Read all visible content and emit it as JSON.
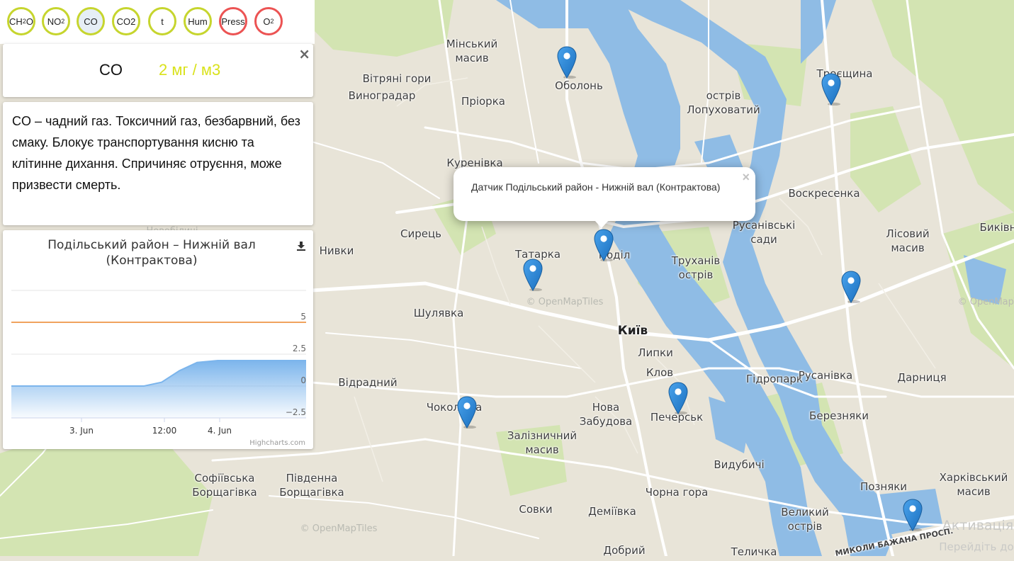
{
  "chips": [
    {
      "label": "CH",
      "sub": "2",
      "tail": "O",
      "color": "#c6d52e"
    },
    {
      "label": "NO",
      "sub": "2",
      "tail": "",
      "color": "#c6d52e"
    },
    {
      "label": "CO",
      "sub": "",
      "tail": "",
      "color": "#c6d52e",
      "active": true
    },
    {
      "label": "CO2",
      "sub": "",
      "tail": "",
      "color": "#c6d52e"
    },
    {
      "label": "t",
      "sub": "",
      "tail": "",
      "color": "#c6d52e"
    },
    {
      "label": "Hum",
      "sub": "",
      "tail": "",
      "color": "#c6d52e"
    },
    {
      "label": "Press",
      "sub": "",
      "tail": "",
      "color": "#ec5353"
    },
    {
      "label": "O",
      "sub": "2",
      "tail": "",
      "color": "#ec5353"
    }
  ],
  "selected_gas": {
    "name": "CO",
    "value": "2 мг / м3",
    "close": "×"
  },
  "description": "CO – чадний газ. Токсичний газ, безбарвний, без смаку. Блокує транспортування кисню та клітинне дихання. Спричиняє отруєння, може призвести смерть.",
  "chart": {
    "title": "Подільський район – Нижній вал (Контрактова)",
    "credits": "Highcharts.com"
  },
  "chart_data": {
    "type": "area",
    "title": "Подільський район – Нижній вал (Контрактова)",
    "xlabel": "",
    "ylabel": "",
    "x_ticks": [
      "3. Jun",
      "12:00",
      "4. Jun"
    ],
    "y_ticks": [
      "5",
      "2.5",
      "0",
      "−2.5"
    ],
    "ylim": [
      -2.5,
      7.5
    ],
    "grid": true,
    "plot_line": {
      "value": 5,
      "color": "#f0a35e"
    },
    "series": [
      {
        "color": "#7cb5ec",
        "x": [
          0,
          0.45,
          0.51,
          0.57,
          0.63,
          0.7,
          1.0
        ],
        "y": [
          0,
          0,
          0.3,
          1.2,
          1.85,
          2.0,
          2.0
        ]
      }
    ]
  },
  "popup": {
    "text": "Датчик Подільський район - Нижній вал (Контрактова)",
    "close": "×"
  },
  "map": {
    "colors": {
      "land": "#e8e4d8",
      "water": "#8fbce5",
      "park": "#d3e4b2",
      "road": "#ffffff"
    },
    "labels": [
      {
        "text": "Мінський\nмасив"
      },
      {
        "text": "Оболонь"
      },
      {
        "text": "Вітряні гори"
      },
      {
        "text": "Виноградар"
      },
      {
        "text": "Пріорка"
      },
      {
        "text": "острів\nЛопуховатий"
      },
      {
        "text": "Троєщина"
      },
      {
        "text": "Куренівка"
      },
      {
        "text": "Воскресенка"
      },
      {
        "text": "Русанівські\nсади"
      },
      {
        "text": "Лісовий\nмасив"
      },
      {
        "text": "Биківня"
      },
      {
        "text": "Сирець"
      },
      {
        "text": "Нивки"
      },
      {
        "text": "Татарка"
      },
      {
        "text": "Поділ"
      },
      {
        "text": "Труханів\nострів"
      },
      {
        "text": "Шулявка"
      },
      {
        "text": "Київ"
      },
      {
        "text": "Липки"
      },
      {
        "text": "Клов"
      },
      {
        "text": "Гідропарк"
      },
      {
        "text": "Русанівка"
      },
      {
        "text": "Дарниця"
      },
      {
        "text": "Відрадний"
      },
      {
        "text": "Чоколівка"
      },
      {
        "text": "Нова\nЗабудова"
      },
      {
        "text": "Печерськ"
      },
      {
        "text": "Березняки"
      },
      {
        "text": "Залізничний\nмасив"
      },
      {
        "text": "Видубичі"
      },
      {
        "text": "Софіївська\nБорщагівка"
      },
      {
        "text": "Південна\nБорщагівка"
      },
      {
        "text": "Позняки"
      },
      {
        "text": "Харківський\nмасив"
      },
      {
        "text": "Чорна гора"
      },
      {
        "text": "Совки"
      },
      {
        "text": "Деміївка"
      },
      {
        "text": "Великий\nострів"
      },
      {
        "text": "Добрий"
      },
      {
        "text": "Теличка"
      },
      {
        "text": "Новобіличі"
      },
      {
        "text": "МИКОЛИ БАЖАНА ПРОСП."
      },
      {
        "text": "© OpenMapTiles"
      },
      {
        "text": "© OpenMapTiles"
      },
      {
        "text": "© OpenMapTiles"
      }
    ],
    "watermark": {
      "title": "Активація",
      "subtitle": "Перейдіть до"
    }
  }
}
